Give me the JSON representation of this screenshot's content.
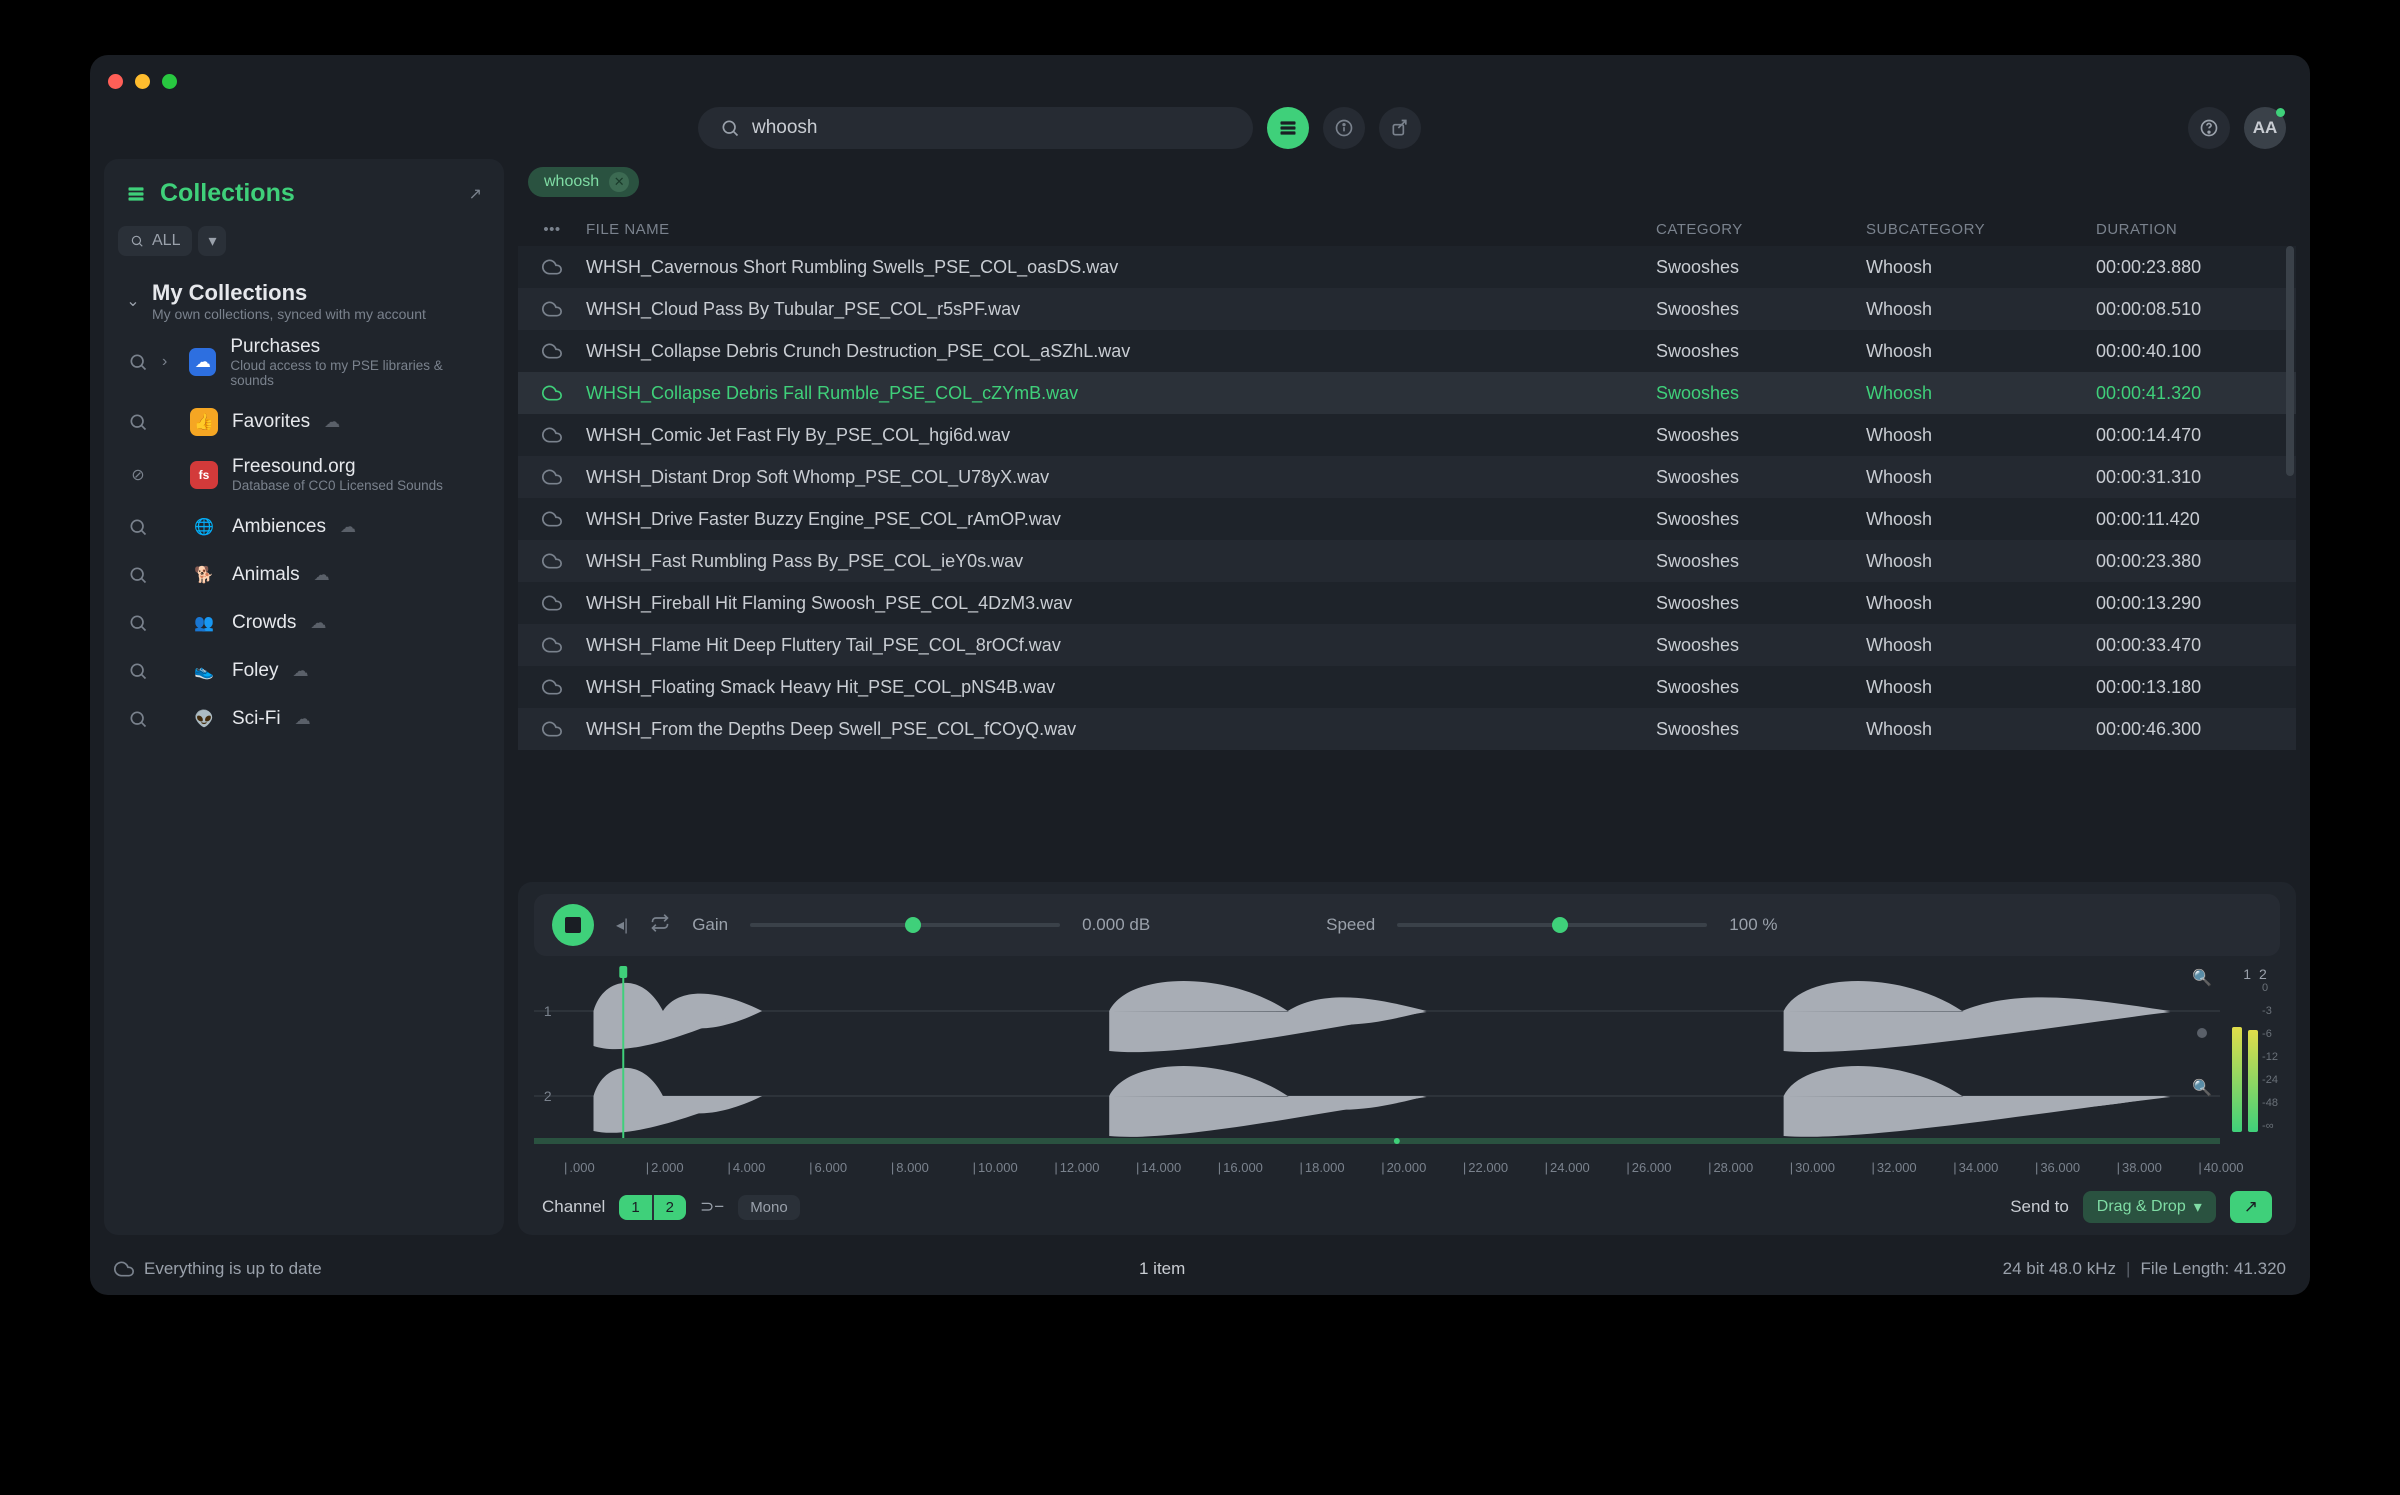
{
  "search": {
    "value": "whoosh",
    "placeholder": ""
  },
  "avatar": "AA",
  "sidebar": {
    "title": "Collections",
    "all_label": "ALL",
    "group": {
      "title": "My Collections",
      "subtitle": "My own collections, synced with my account"
    },
    "items": [
      {
        "label": "Purchases",
        "sub": "Cloud access to my PSE libraries & sounds",
        "icon": "cloud-blue",
        "chev": true
      },
      {
        "label": "Favorites",
        "icon": "thumb-orange",
        "cloud": true
      },
      {
        "label": "Freesound.org",
        "sub": "Database of CC0 Licensed Sounds",
        "icon": "fs-red",
        "muted": true
      },
      {
        "label": "Ambiences",
        "icon": "globe",
        "cloud": true
      },
      {
        "label": "Animals",
        "icon": "dog",
        "cloud": true
      },
      {
        "label": "Crowds",
        "icon": "people",
        "cloud": true
      },
      {
        "label": "Foley",
        "icon": "shoe",
        "cloud": true
      },
      {
        "label": "Sci-Fi",
        "icon": "alien",
        "cloud": true
      }
    ]
  },
  "filter_tag": "whoosh",
  "columns": {
    "name": "FILE NAME",
    "category": "CATEGORY",
    "subcategory": "SUBCATEGORY",
    "duration": "DURATION"
  },
  "rows": [
    {
      "name": "WHSH_Cavernous Short Rumbling Swells_PSE_COL_oasDS.wav",
      "cat": "Swooshes",
      "sub": "Whoosh",
      "dur": "00:00:23.880"
    },
    {
      "name": "WHSH_Cloud Pass By Tubular_PSE_COL_r5sPF.wav",
      "cat": "Swooshes",
      "sub": "Whoosh",
      "dur": "00:00:08.510"
    },
    {
      "name": "WHSH_Collapse Debris Crunch Destruction_PSE_COL_aSZhL.wav",
      "cat": "Swooshes",
      "sub": "Whoosh",
      "dur": "00:00:40.100"
    },
    {
      "name": "WHSH_Collapse Debris Fall Rumble_PSE_COL_cZYmB.wav",
      "cat": "Swooshes",
      "sub": "Whoosh",
      "dur": "00:00:41.320",
      "selected": true
    },
    {
      "name": "WHSH_Comic Jet Fast Fly By_PSE_COL_hgi6d.wav",
      "cat": "Swooshes",
      "sub": "Whoosh",
      "dur": "00:00:14.470"
    },
    {
      "name": "WHSH_Distant Drop Soft Whomp_PSE_COL_U78yX.wav",
      "cat": "Swooshes",
      "sub": "Whoosh",
      "dur": "00:00:31.310"
    },
    {
      "name": "WHSH_Drive Faster Buzzy Engine_PSE_COL_rAmOP.wav",
      "cat": "Swooshes",
      "sub": "Whoosh",
      "dur": "00:00:11.420"
    },
    {
      "name": "WHSH_Fast Rumbling Pass By_PSE_COL_ieY0s.wav",
      "cat": "Swooshes",
      "sub": "Whoosh",
      "dur": "00:00:23.380"
    },
    {
      "name": "WHSH_Fireball Hit Flaming Swoosh_PSE_COL_4DzM3.wav",
      "cat": "Swooshes",
      "sub": "Whoosh",
      "dur": "00:00:13.290"
    },
    {
      "name": "WHSH_Flame Hit Deep Fluttery Tail_PSE_COL_8rOCf.wav",
      "cat": "Swooshes",
      "sub": "Whoosh",
      "dur": "00:00:33.470"
    },
    {
      "name": "WHSH_Floating Smack Heavy Hit_PSE_COL_pNS4B.wav",
      "cat": "Swooshes",
      "sub": "Whoosh",
      "dur": "00:00:13.180"
    },
    {
      "name": "WHSH_From the Depths Deep Swell_PSE_COL_fCOyQ.wav",
      "cat": "Swooshes",
      "sub": "Whoosh",
      "dur": "00:00:46.300"
    }
  ],
  "player": {
    "gain_label": "Gain",
    "gain_value": "0.000 dB",
    "speed_label": "Speed",
    "speed_value": "100 %",
    "channel_label": "Channel",
    "channels": [
      "1",
      "2"
    ],
    "mono_label": "Mono",
    "send_to_label": "Send to",
    "drag_drop": "Drag & Drop",
    "meter_labels": [
      "1",
      "2"
    ],
    "meter_scale": [
      "0",
      "-3",
      "-6",
      "-12",
      "-24",
      "-48",
      "-∞"
    ]
  },
  "timeline_ticks": [
    ".000",
    "2.000",
    "4.000",
    "6.000",
    "8.000",
    "10.000",
    "12.000",
    "14.000",
    "16.000",
    "18.000",
    "20.000",
    "22.000",
    "24.000",
    "26.000",
    "28.000",
    "30.000",
    "32.000",
    "34.000",
    "36.000",
    "38.000",
    "40.000"
  ],
  "status": {
    "sync": "Everything is up to date",
    "selection": "1 item",
    "format": "24 bit 48.0 kHz",
    "length": "File Length: 41.320"
  }
}
